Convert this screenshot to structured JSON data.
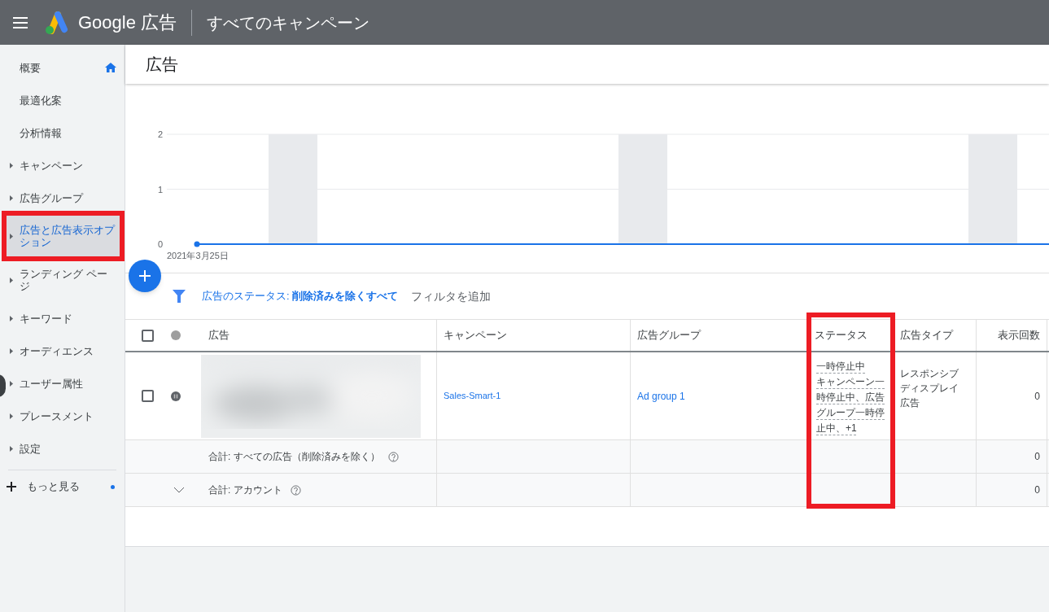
{
  "top_bar": {
    "product": "Google 広告",
    "title": "すべてのキャンペーン"
  },
  "sidebar": {
    "items": [
      {
        "label": "概要",
        "kind": "home",
        "selected": false,
        "highlighted": false
      },
      {
        "label": "最適化案",
        "kind": "plain",
        "selected": false,
        "highlighted": false
      },
      {
        "label": "分析情報",
        "kind": "plain",
        "selected": false,
        "highlighted": false
      },
      {
        "label": "キャンペーン",
        "kind": "caret",
        "selected": false,
        "highlighted": false
      },
      {
        "label": "広告グループ",
        "kind": "caret",
        "selected": false,
        "highlighted": false
      },
      {
        "label": "広告と広告表示オプション",
        "kind": "caret",
        "selected": true,
        "highlighted": true
      },
      {
        "label": "ランディング ページ",
        "kind": "caret",
        "selected": false,
        "highlighted": false
      },
      {
        "label": "キーワード",
        "kind": "caret",
        "selected": false,
        "highlighted": false
      },
      {
        "label": "オーディエンス",
        "kind": "caret",
        "selected": false,
        "highlighted": false
      },
      {
        "label": "ユーザー属性",
        "kind": "caret",
        "selected": false,
        "highlighted": false
      },
      {
        "label": "プレースメント",
        "kind": "caret",
        "selected": false,
        "highlighted": false
      },
      {
        "label": "設定",
        "kind": "caret",
        "selected": false,
        "highlighted": false
      }
    ],
    "more": "もっと見る"
  },
  "page_title": "広告",
  "chart": {
    "chart_data": {
      "type": "line",
      "categories": [
        "2021年3月25日"
      ],
      "yticks": [
        0,
        1,
        2
      ],
      "ylim": [
        0,
        2
      ],
      "series": [
        {
          "color": "#1a73e8",
          "marker": "circle",
          "values": [
            0
          ]
        }
      ]
    }
  },
  "filter": {
    "label": "広告のステータス: ",
    "value": "削除済みを除くすべて",
    "add": "フィルタを追加"
  },
  "table": {
    "header_checked": false,
    "columns": [
      {
        "label": "広告",
        "highlighted": false
      },
      {
        "label": "キャンペーン",
        "highlighted": false
      },
      {
        "label": "広告グループ",
        "highlighted": false
      },
      {
        "label": "ステータス",
        "highlighted": true
      },
      {
        "label": "広告タイプ",
        "highlighted": false
      },
      {
        "label": "表示回数",
        "highlighted": false
      }
    ],
    "rows": [
      {
        "checked": false,
        "ad": {
          "kind": "picture"
        },
        "campaign": "Sales-Smart-1",
        "ad_group": "Ad group 1",
        "status": [
          "一時停止中",
          "キャンペーン一時停止中、広告グループ一時停止中、+1"
        ],
        "ad_type": "レスポンシブディスプレイ広告",
        "impressions": "0"
      }
    ],
    "totals": [
      {
        "label": "合計: すべての広告（削除済みを除く）",
        "expandable": false,
        "impressions": "0"
      },
      {
        "label": "合計: アカウント",
        "expandable": true,
        "impressions": "0"
      }
    ]
  }
}
